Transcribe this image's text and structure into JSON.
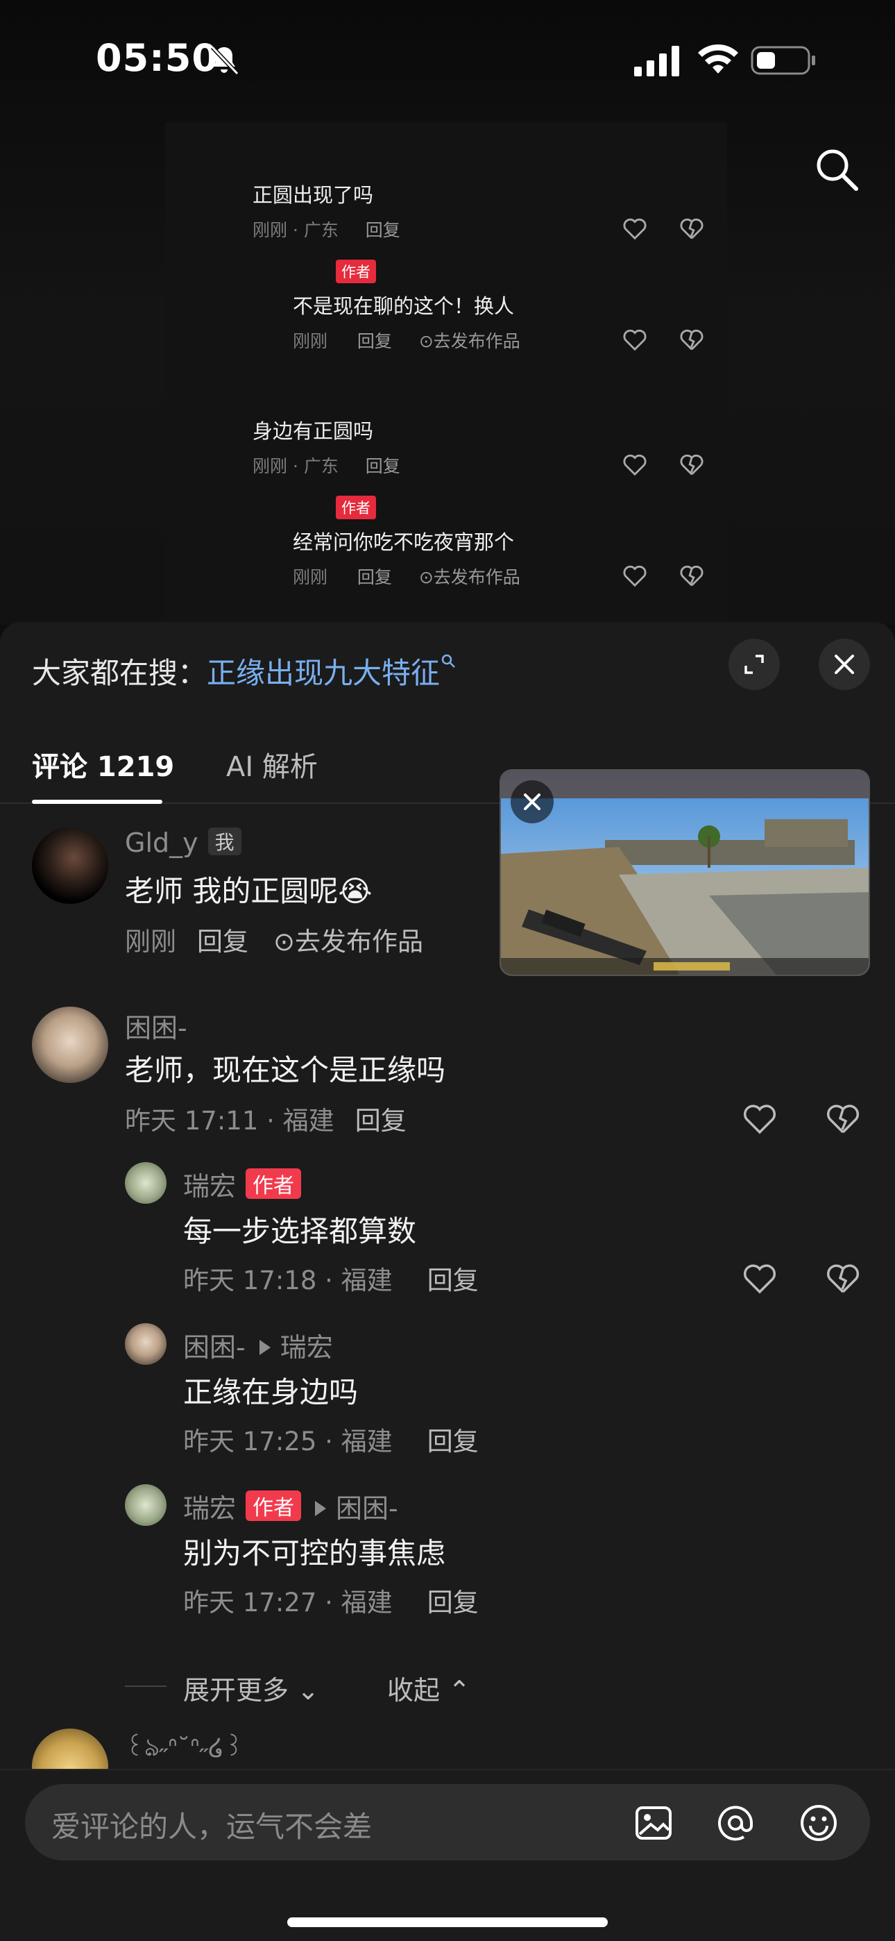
{
  "status_bar": {
    "time": "05:50"
  },
  "overlay_comments": [
    {
      "text": "正圆出现了吗",
      "meta": "刚刚 · 广东",
      "reply": "回复"
    },
    {
      "badge": "作者",
      "text": "不是现在聊的这个！换人",
      "meta": "刚刚",
      "reply": "回复",
      "publish": "去发布作品"
    },
    {
      "text": "身边有正圆吗",
      "meta": "刚刚 · 广东",
      "reply": "回复"
    },
    {
      "badge": "作者",
      "text": "经常问你吃不吃夜宵那个",
      "meta": "刚刚",
      "reply": "回复",
      "publish": "去发布作品"
    }
  ],
  "search_hint": {
    "prefix": "大家都在搜：",
    "keyword": "正缘出现九大特征"
  },
  "tabs": {
    "comments": "评论 1219",
    "ai": "AI 解析"
  },
  "comments": [
    {
      "name": "Gld_y",
      "badge": "我",
      "text": "老师 我的正圆呢😭",
      "meta": "刚刚",
      "reply": "回复",
      "publish": "去发布作品"
    },
    {
      "name": "困困-",
      "text": "老师，现在这个是正缘吗",
      "meta": "昨天 17:11 · 福建",
      "reply": "回复"
    }
  ],
  "replies": [
    {
      "name": "瑞宏",
      "badge": "作者",
      "text": "每一步选择都算数",
      "meta": "昨天 17:18 · 福建",
      "reply": "回复"
    },
    {
      "name": "困困-",
      "to": "瑞宏",
      "text": "正缘在身边吗",
      "meta": "昨天 17:25 · 福建",
      "reply": "回复"
    },
    {
      "name": "瑞宏",
      "badge": "作者",
      "to": "困困-",
      "text": "别为不可控的事焦虑",
      "meta": "昨天 17:27 · 福建",
      "reply": "回复"
    }
  ],
  "thread_controls": {
    "expand": "展开更多",
    "collapse": "收起"
  },
  "next_comment": {
    "name": "꒰ঌ˶ᐢ˘ᐢ˶໒꒱"
  },
  "input": {
    "placeholder": "爱评论的人，运气不会差"
  },
  "colors": {
    "author_badge": "#f23a4d",
    "keyword": "#79aff0",
    "panel": "#1b1b1b"
  }
}
